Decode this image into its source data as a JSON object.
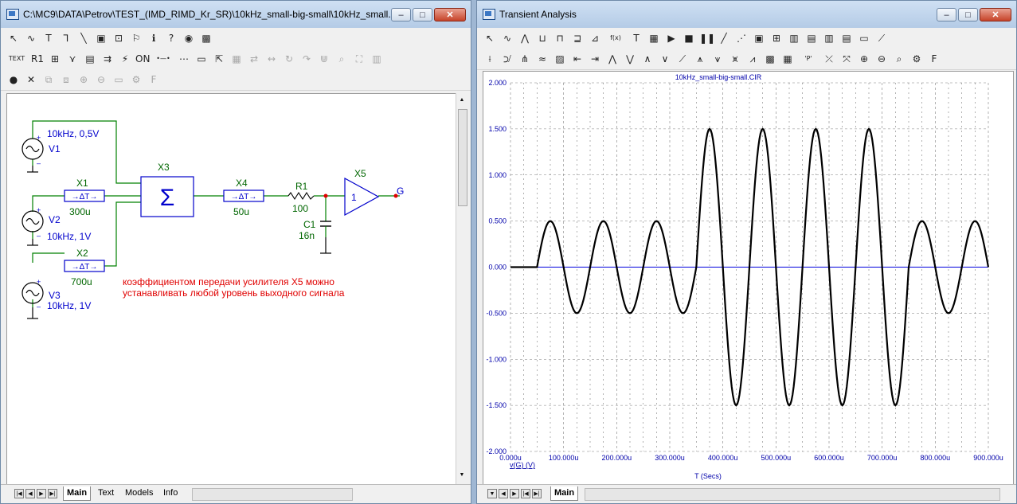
{
  "schematic_window": {
    "title": "C:\\MC9\\DATA\\Petrov\\TEST_(IMD_RIMD_Kr_SR)\\10kHz_small-big-small\\10kHz_small...",
    "controls": {
      "minimize": "–",
      "maximize": "□",
      "close": "✕"
    },
    "toolbar_row1": [
      {
        "name": "select-arrow-icon",
        "glyph": "↖"
      },
      {
        "name": "wire-mode-icon",
        "glyph": "∿"
      },
      {
        "name": "text-tool-icon",
        "glyph": "T"
      },
      {
        "name": "wire-icon",
        "glyph": "⅂"
      },
      {
        "name": "diagonal-wire-icon",
        "glyph": "╲"
      },
      {
        "name": "component-icon",
        "glyph": "▣"
      },
      {
        "name": "graphics-icon",
        "glyph": "⊡"
      },
      {
        "name": "flag-icon",
        "glyph": "⚐"
      },
      {
        "name": "info-icon",
        "glyph": "ℹ"
      },
      {
        "name": "help-icon",
        "glyph": "?"
      },
      {
        "name": "point-to-end-icon",
        "glyph": "◉"
      },
      {
        "name": "probe-icon",
        "glyph": "▩"
      }
    ],
    "toolbar_row2": [
      {
        "name": "text-icon",
        "glyph": "TEXT"
      },
      {
        "name": "attribute-icon",
        "glyph": "R1"
      },
      {
        "name": "node-number-icon",
        "glyph": "⊞"
      },
      {
        "name": "pin-connection-icon",
        "glyph": "⋎"
      },
      {
        "name": "show-voltage-icon",
        "glyph": "▤"
      },
      {
        "name": "current-icon",
        "glyph": "⇉"
      },
      {
        "name": "power-icon",
        "glyph": "⚡"
      },
      {
        "name": "on-state-icon",
        "glyph": "ON"
      },
      {
        "name": "pin-icon",
        "glyph": "•—•"
      },
      {
        "name": "grid-icon",
        "glyph": "⋯"
      },
      {
        "name": "border-icon",
        "glyph": "▭"
      },
      {
        "name": "select-cursor-icon",
        "glyph": "⇱"
      },
      {
        "name": "properties-icon",
        "glyph": "▦"
      },
      {
        "name": "mirror-icon",
        "glyph": "⇄"
      },
      {
        "name": "flip-icon",
        "glyph": "↔"
      },
      {
        "name": "rotate-icon",
        "glyph": "↻"
      },
      {
        "name": "step-icon",
        "glyph": "↷"
      },
      {
        "name": "split-icon",
        "glyph": "⋓"
      },
      {
        "name": "find-icon",
        "glyph": "⌕"
      },
      {
        "name": "binoculars-icon",
        "glyph": "⛶"
      },
      {
        "name": "notes-icon",
        "glyph": "▥"
      }
    ],
    "toolbar_row3": [
      {
        "name": "stop-red-icon",
        "glyph": "●"
      },
      {
        "name": "cancel-icon",
        "glyph": "✕"
      },
      {
        "name": "copy-icon",
        "glyph": "⧉"
      },
      {
        "name": "paste-icon",
        "glyph": "⧈"
      },
      {
        "name": "zoom-in-icon",
        "glyph": "⊕"
      },
      {
        "name": "zoom-out-icon",
        "glyph": "⊖"
      },
      {
        "name": "folder-icon",
        "glyph": "▭"
      },
      {
        "name": "settings-icon",
        "glyph": "⚙"
      },
      {
        "name": "font-icon",
        "glyph": "F"
      }
    ],
    "components": {
      "v1": {
        "ref": "V1",
        "value": "10kHz, 0,5V"
      },
      "v2": {
        "ref": "V2",
        "value": "10kHz, 1V"
      },
      "v3": {
        "ref": "V3",
        "value": "10kHz, 1V"
      },
      "x1": {
        "ref": "X1",
        "delay": "300u"
      },
      "x2": {
        "ref": "X2",
        "delay": "700u"
      },
      "x3": {
        "ref": "X3"
      },
      "x4": {
        "ref": "X4",
        "delay": "50u"
      },
      "x5": {
        "ref": "X5",
        "gain": "1"
      },
      "r1": {
        "ref": "R1",
        "value": "100"
      },
      "c1": {
        "ref": "C1",
        "value": "16n"
      },
      "node_g": "G",
      "plus_sign": "+",
      "minus_sign": "–",
      "sum_symbol": "Σ",
      "delay_symbol": "→ΔT→"
    },
    "note_line1": "коэффициентом передачи усилителя X5 можно",
    "note_line2": "устанавливать любой уровень выходного сигнала",
    "tabs": [
      "Main",
      "Text",
      "Models",
      "Info"
    ],
    "active_tab": "Main",
    "colors": {
      "wire": "#008000",
      "component": "#0000cc",
      "label_green": "#006600",
      "note": "#e00000",
      "node": "#e00000"
    }
  },
  "analysis_window": {
    "title": "Transient Analysis",
    "controls": {
      "minimize": "–",
      "maximize": "□",
      "close": "✕"
    },
    "toolbar_row1": [
      {
        "name": "select-arrow-icon",
        "glyph": "↖"
      },
      {
        "name": "scale-icon",
        "glyph": "∿"
      },
      {
        "name": "peak-icon",
        "glyph": "⋀"
      },
      {
        "name": "valley-icon",
        "glyph": "⊔"
      },
      {
        "name": "high-icon",
        "glyph": "⊓"
      },
      {
        "name": "low-icon",
        "glyph": "⊒"
      },
      {
        "name": "slope-icon",
        "glyph": "⊿"
      },
      {
        "name": "function-icon",
        "glyph": "f(x)"
      },
      {
        "name": "text-icon",
        "glyph": "T"
      },
      {
        "name": "properties-icon",
        "glyph": "▦"
      },
      {
        "name": "run-icon",
        "glyph": "▶"
      },
      {
        "name": "stop-icon",
        "glyph": "■"
      },
      {
        "name": "pause-icon",
        "glyph": "❚❚"
      },
      {
        "name": "line-icon",
        "glyph": "╱"
      },
      {
        "name": "dotted-line-icon",
        "glyph": "⋰"
      },
      {
        "name": "box-icon",
        "glyph": "▣"
      },
      {
        "name": "grid-icon",
        "glyph": "⊞"
      },
      {
        "name": "layout-1-icon",
        "glyph": "▥"
      },
      {
        "name": "layout-2-icon",
        "glyph": "▤"
      },
      {
        "name": "layout-3-icon",
        "glyph": "▥"
      },
      {
        "name": "layout-4-icon",
        "glyph": "▤"
      },
      {
        "name": "baseline-icon",
        "glyph": "▭"
      },
      {
        "name": "trend-icon",
        "glyph": "⟋"
      }
    ],
    "toolbar_row2": [
      {
        "name": "cursor-left-icon",
        "glyph": "⟊"
      },
      {
        "name": "cursor-right-icon",
        "glyph": "⟉"
      },
      {
        "name": "tracker-icon",
        "glyph": "⋔"
      },
      {
        "name": "wave-icon",
        "glyph": "≈"
      },
      {
        "name": "chart-icon",
        "glyph": "▨"
      },
      {
        "name": "next-left-icon",
        "glyph": "⇤"
      },
      {
        "name": "next-right-icon",
        "glyph": "⇥"
      },
      {
        "name": "peak-a-icon",
        "glyph": "⋀"
      },
      {
        "name": "valley-a-icon",
        "glyph": "⋁"
      },
      {
        "name": "peak-b-icon",
        "glyph": "∧"
      },
      {
        "name": "valley-b-icon",
        "glyph": "∨"
      },
      {
        "name": "slope-a-icon",
        "glyph": "⟋"
      },
      {
        "name": "rise-icon",
        "glyph": "⩚"
      },
      {
        "name": "fall-icon",
        "glyph": "⩛"
      },
      {
        "name": "inflect-icon",
        "glyph": "⩙"
      },
      {
        "name": "bookmark-icon",
        "glyph": "⩘"
      },
      {
        "name": "palette-icon",
        "glyph": "▩"
      },
      {
        "name": "table-icon",
        "glyph": "▦"
      },
      {
        "name": "p-icon",
        "glyph": "'P'"
      },
      {
        "name": "marker-a-icon",
        "glyph": "⤫"
      },
      {
        "name": "marker-b-icon",
        "glyph": "⤧"
      },
      {
        "name": "zoom-in-icon",
        "glyph": "⊕"
      },
      {
        "name": "zoom-out-icon",
        "glyph": "⊖"
      },
      {
        "name": "zoom-fit-icon",
        "glyph": "⌕"
      },
      {
        "name": "settings-icon",
        "glyph": "⚙"
      },
      {
        "name": "font-icon",
        "glyph": "F"
      }
    ],
    "tabs": [
      "Main"
    ],
    "active_tab": "Main",
    "plot_title": "10kHz_small-big-small.CIR",
    "trace_label": "v(G) (V)",
    "x_axis_label": "T (Secs)",
    "colors": {
      "trace": "#000000",
      "baseline": "#0000dd",
      "grid": "#808080",
      "axis_text": "#0000aa"
    }
  },
  "chart_data": {
    "type": "line",
    "title": "10kHz_small-big-small.CIR",
    "xlabel": "T (Secs)",
    "ylabel": "v(G) (V)",
    "x_ticks": [
      "0.000u",
      "100.000u",
      "200.000u",
      "300.000u",
      "400.000u",
      "500.000u",
      "600.000u",
      "700.000u",
      "800.000u",
      "900.000u"
    ],
    "y_ticks": [
      "2.000",
      "1.500",
      "1.000",
      "0.500",
      "0.000",
      "-0.500",
      "-1.000",
      "-1.500",
      "-2.000"
    ],
    "xlim": [
      0,
      0.0009
    ],
    "ylim": [
      -2,
      2
    ],
    "grid": true,
    "series": [
      {
        "name": "v(G) (V)",
        "x": [
          0,
          5e-05,
          7.5e-05,
          0.0001,
          0.000125,
          0.00015,
          0.000175,
          0.0002,
          0.000225,
          0.00025,
          0.000275,
          0.0003,
          0.000325,
          0.00035,
          0.000375,
          0.0004,
          0.000425,
          0.00045,
          0.000475,
          0.0005,
          0.000525,
          0.00055,
          0.000575,
          0.0006,
          0.000625,
          0.00065,
          0.000675,
          0.0007,
          0.000725,
          0.00075,
          0.000775,
          0.0008,
          0.000825,
          0.00085,
          0.000875,
          0.0009
        ],
        "y": [
          0,
          0,
          0.5,
          0,
          -0.5,
          0,
          0.5,
          0,
          -0.5,
          0,
          0.5,
          0,
          -0.5,
          0,
          1.5,
          0,
          -1.5,
          0,
          1.5,
          0,
          -1.5,
          0,
          1.5,
          0,
          -1.5,
          0,
          1.5,
          0,
          -1.5,
          0,
          0.5,
          0,
          -0.5,
          0,
          0.5,
          0
        ]
      },
      {
        "name": "baseline",
        "x": [
          0,
          0.0009
        ],
        "y": [
          0,
          0
        ]
      }
    ]
  }
}
